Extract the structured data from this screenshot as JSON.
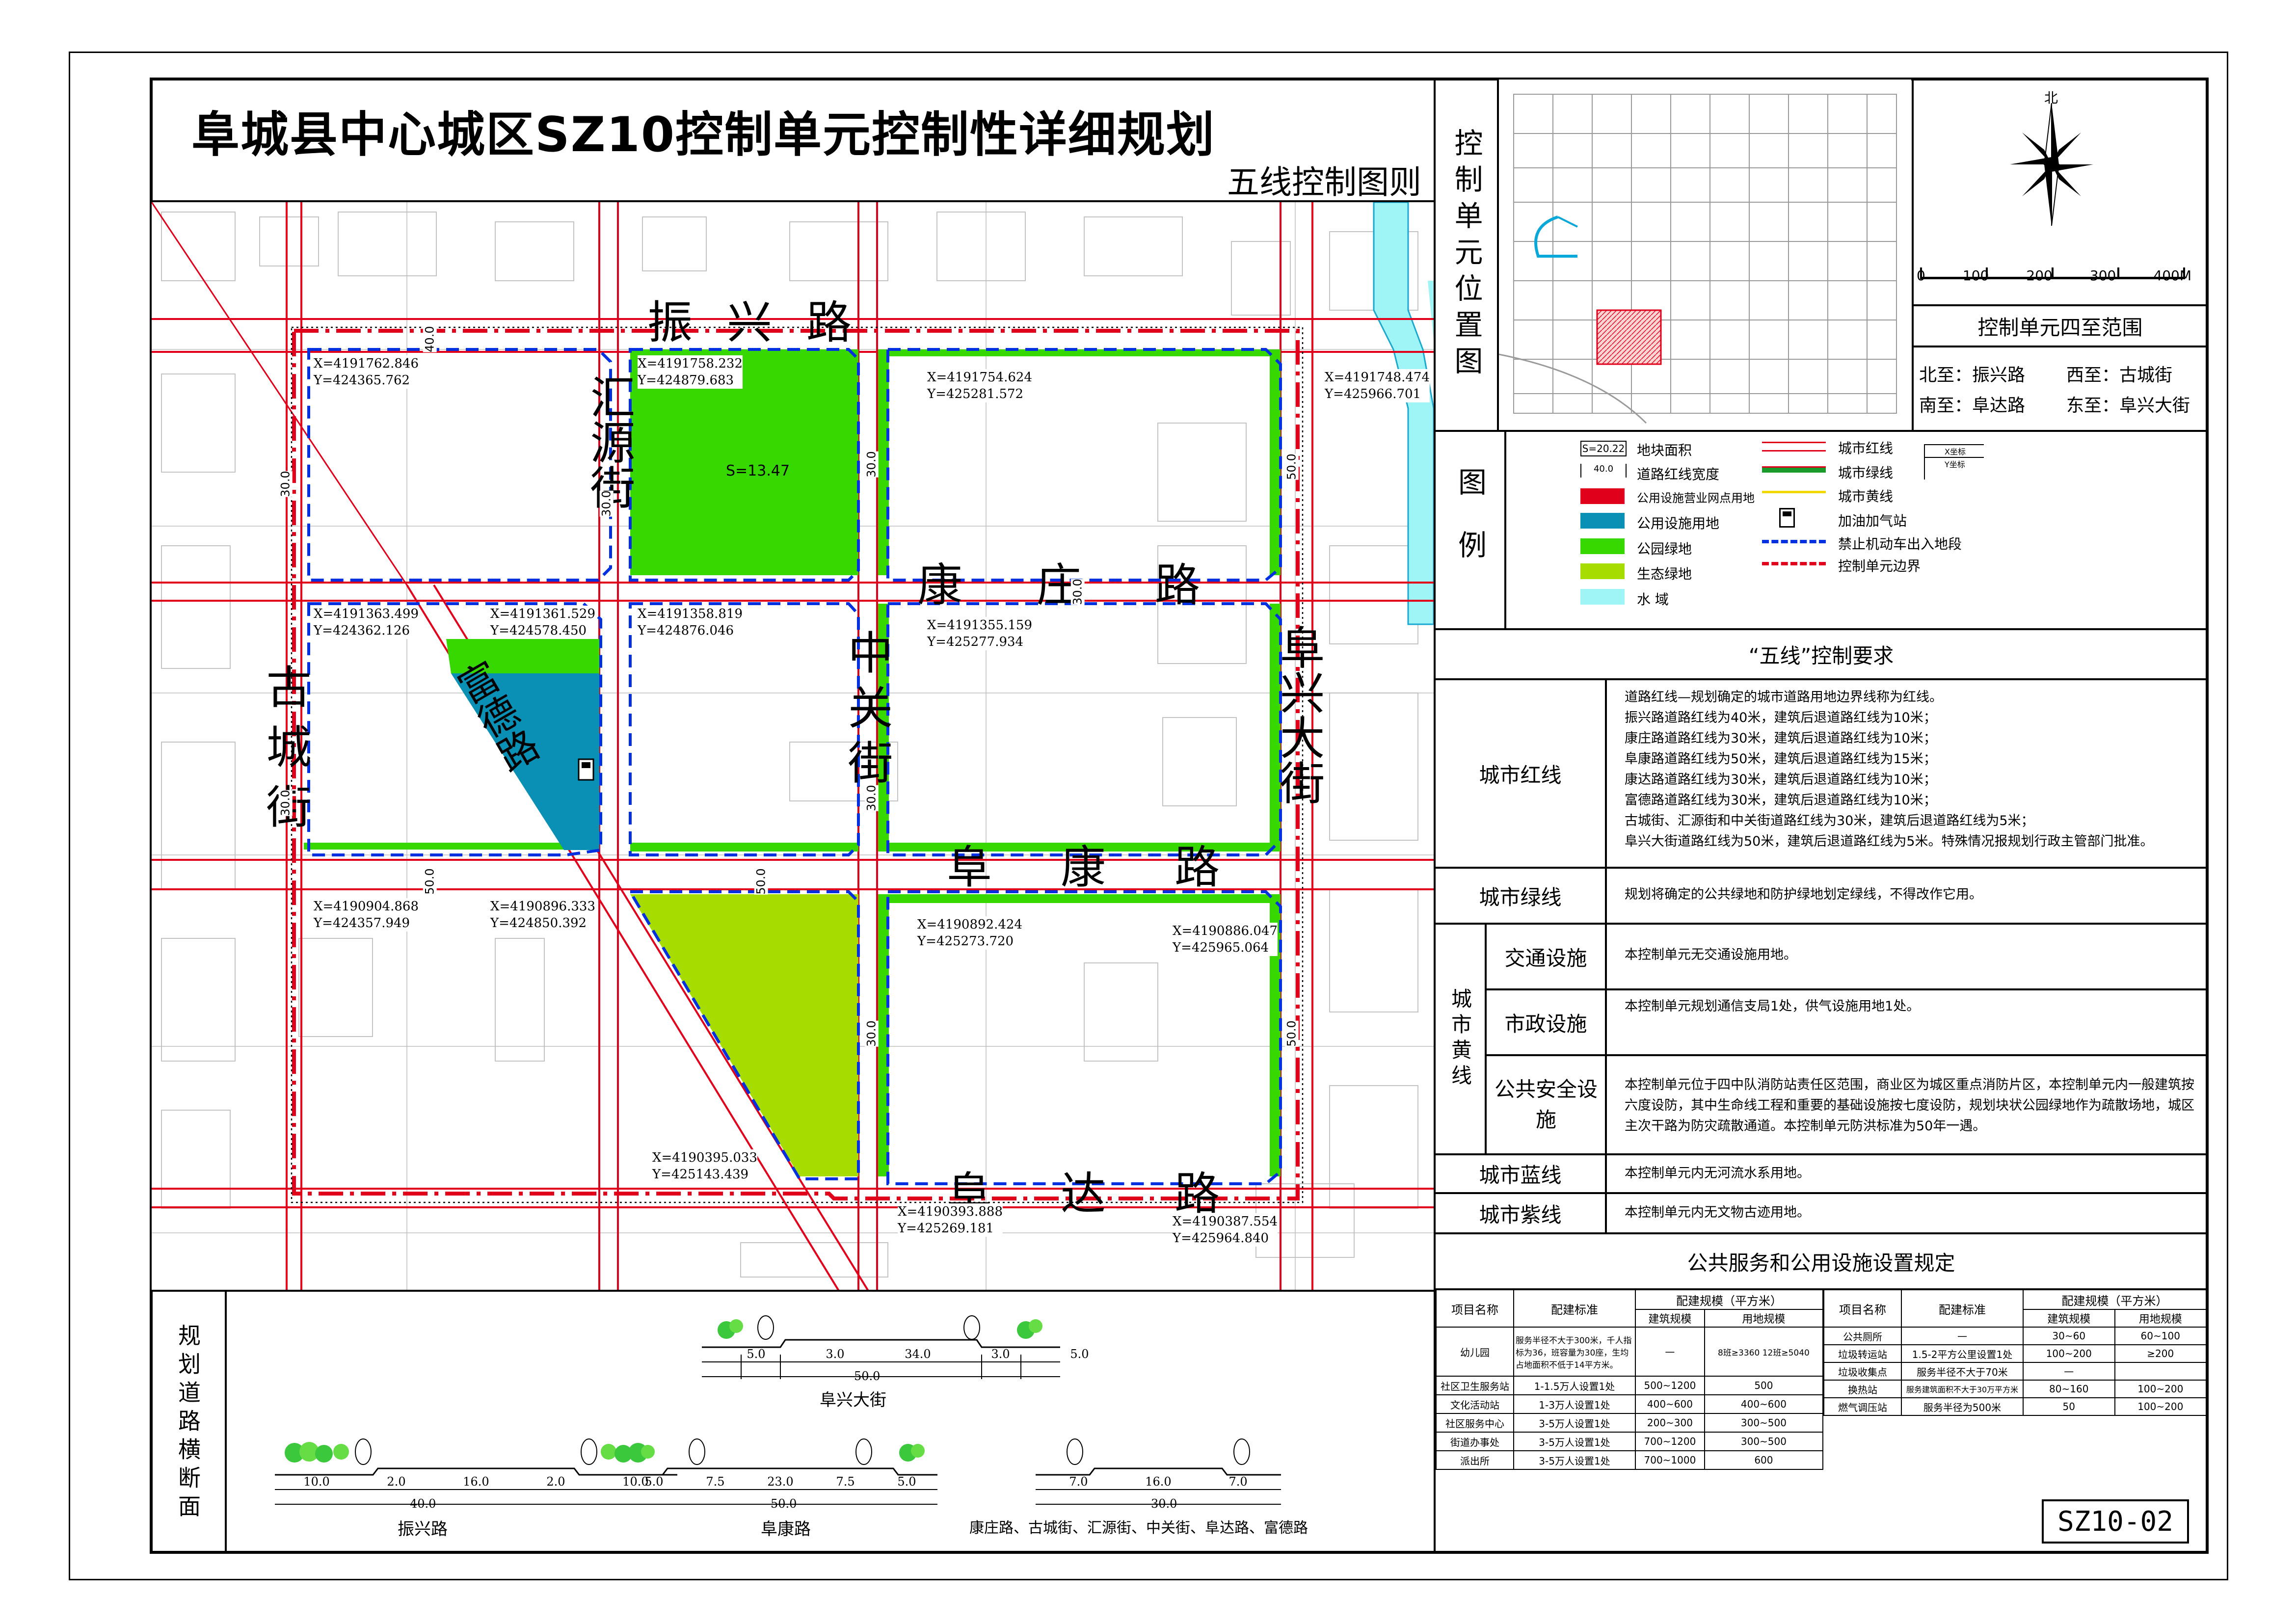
{
  "title": "阜城县中心城区SZ10控制单元控制性详细规划",
  "subtitle": "五线控制图则",
  "drawing_no": "SZ10-02",
  "roads": {
    "zhenxing": "振兴路",
    "kangzhuang": "康庄路",
    "fukang": "阜康路",
    "fuda": "阜达路",
    "gucheng": "古城街",
    "huiyuan": "汇源街",
    "zhongguan": "中关街",
    "fuxing": "阜兴大街",
    "fude": "富德路"
  },
  "parcel_area": "S=13.47",
  "coords": [
    {
      "x": "X=4191762.846",
      "y": "Y=424365.762"
    },
    {
      "x": "X=4191758.232",
      "y": "Y=424879.683"
    },
    {
      "x": "X=4191754.624",
      "y": "Y=425281.572"
    },
    {
      "x": "X=4191748.474",
      "y": "Y=425966.701"
    },
    {
      "x": "X=4191363.499",
      "y": "Y=424362.126"
    },
    {
      "x": "X=4191361.529",
      "y": "Y=424578.450"
    },
    {
      "x": "X=4191358.819",
      "y": "Y=424876.046"
    },
    {
      "x": "X=4191355.159",
      "y": "Y=425277.934"
    },
    {
      "x": "X=4190904.868",
      "y": "Y=424357.949"
    },
    {
      "x": "X=4190896.333",
      "y": "Y=424850.392"
    },
    {
      "x": "X=4190892.424",
      "y": "Y=425273.720"
    },
    {
      "x": "X=4190886.047",
      "y": "Y=425965.064"
    },
    {
      "x": "X=4190395.033",
      "y": "Y=425143.439"
    },
    {
      "x": "X=4190393.888",
      "y": "Y=425269.181"
    },
    {
      "x": "X=4190387.554",
      "y": "Y=425964.840"
    }
  ],
  "widths": [
    "30.0",
    "30.0",
    "40.0",
    "50.0",
    "50.0",
    "30.0",
    "30.0",
    "30.0",
    "50.0",
    "30.0",
    "30.0",
    "50.0"
  ],
  "location_panel": {
    "title": "控制单元位置图",
    "north": "北",
    "scale": [
      "0",
      "100",
      "200",
      "300",
      "400M"
    ],
    "bounds_title": "控制单元四至范围",
    "bounds": [
      {
        "label": "北至：振兴路"
      },
      {
        "label": "西至：古城街"
      },
      {
        "label": "南至：阜达路"
      },
      {
        "label": "东至：阜兴大街"
      }
    ]
  },
  "legend": {
    "title": "图例",
    "items_left": [
      {
        "sample": "S=20.22",
        "label": "地块面积"
      },
      {
        "sample": "40.0",
        "label": "道路红线宽度"
      },
      {
        "label": "公用设施营业网点用地",
        "color": "#e0001b"
      },
      {
        "label": "公用设施用地",
        "color": "#0a8fb5"
      },
      {
        "label": "公园绿地",
        "color": "#37d800"
      },
      {
        "label": "生态绿地",
        "color": "#a6dc00"
      },
      {
        "label": "水    域",
        "color": "#9ff5f6"
      }
    ],
    "items_right": [
      {
        "label": "城市红线",
        "color": "#e0001b"
      },
      {
        "label": "城市绿线",
        "color": "#1a9a2a"
      },
      {
        "label": "城市黄线",
        "color": "#f0d800"
      },
      {
        "label": "加油加气站"
      },
      {
        "label": "禁止机动车出入地段",
        "color": "#0030e0"
      },
      {
        "label": "控制单元边界",
        "color": "#e0001b"
      }
    ],
    "coord_sample": {
      "x": "X坐标",
      "y": "Y坐标"
    }
  },
  "requirements": {
    "title": "“五线”控制要求",
    "red_line": {
      "label": "城市红线",
      "lines": [
        "道路红线—规划确定的城市道路用地边界线称为红线。",
        "振兴路道路红线为40米，建筑后退道路红线为10米；",
        "康庄路道路红线为30米，建筑后退道路红线为10米；",
        "阜康路道路红线为50米，建筑后退道路红线为15米；",
        "康达路道路红线为30米，建筑后退道路红线为10米；",
        "富德路道路红线为30米，建筑后退道路红线为10米；",
        "古城街、汇源街和中关街道路红线为30米，建筑后退道路红线为5米；",
        "阜兴大街道路红线为50米，建筑后退道路红线为5米。特殊情况报规划行政主管部门批准。"
      ]
    },
    "green_line": {
      "label": "城市绿线",
      "text": "规划将确定的公共绿地和防护绿地划定绿线，不得改作它用。"
    },
    "yellow_line": {
      "label": "城市黄线",
      "rows": [
        {
          "label": "交通设施",
          "text": "本控制单元无交通设施用地。"
        },
        {
          "label": "市政设施",
          "text": "本控制单元规划通信支局1处，供气设施用地1处。"
        },
        {
          "label": "公共安全设施",
          "text": "本控制单元位于四中队消防站责任区范围，商业区为城区重点消防片区，本控制单元内一般建筑按六度设防，其中生命线工程和重要的基础设施按七度设防，规划块状公园绿地作为疏散场地，城区主次干路为防灾疏散通道。本控制单元防洪标准为50年一遇。"
        }
      ]
    },
    "blue_line": {
      "label": "城市蓝线",
      "text": "本控制单元内无河流水系用地。"
    },
    "purple_line": {
      "label": "城市紫线",
      "text": "本控制单元内无文物古迹用地。"
    }
  },
  "services": {
    "title": "公共服务和公用设施设置规定",
    "headers": {
      "item": "项目名称",
      "standard": "配建标准",
      "scale": "配建规模（平方米）",
      "building": "建筑规模",
      "land": "用地规模"
    },
    "left_rows": [
      {
        "item": "幼儿园",
        "standard": "服务半径不大于300米，千人指标为36，班容量为30座，生均占地面积不低于14平方米。",
        "building": "—",
        "land": "8班≥3360 12班≥5040"
      },
      {
        "item": "社区卫生服务站",
        "standard": "1-1.5万人设置1处",
        "building": "500~1200",
        "land": "500"
      },
      {
        "item": "文化活动站",
        "standard": "1-3万人设置1处",
        "building": "400~600",
        "land": "400~600"
      },
      {
        "item": "社区服务中心",
        "standard": "3-5万人设置1处",
        "building": "200~300",
        "land": "300~500"
      },
      {
        "item": "街道办事处",
        "standard": "3-5万人设置1处",
        "building": "700~1200",
        "land": "300~500"
      },
      {
        "item": "派出所",
        "standard": "3-5万人设置1处",
        "building": "700~1000",
        "land": "600"
      }
    ],
    "right_rows": [
      {
        "item": "公共厕所",
        "standard": "—",
        "building": "30~60",
        "land": "60~100"
      },
      {
        "item": "垃圾转运站",
        "standard": "1.5-2平方公里设置1处",
        "building": "100~200",
        "land": "≥200"
      },
      {
        "item": "垃圾收集点",
        "standard": "服务半径不大于70米",
        "building": "—",
        "land": ""
      },
      {
        "item": "换热站",
        "standard": "服务建筑面积不大于30万平方米",
        "building": "80~160",
        "land": "100~200"
      },
      {
        "item": "燃气调压站",
        "standard": "服务半径为500米",
        "building": "50",
        "land": "100~200"
      }
    ]
  },
  "sections": {
    "title": "规划道路横断面",
    "fuxing": {
      "name": "阜兴大街",
      "dims": [
        "5.0",
        "3.0",
        "34.0",
        "3.0",
        "5.0"
      ],
      "total": "50.0"
    },
    "zhenxing": {
      "name": "振兴路",
      "dims": [
        "10.0",
        "2.0",
        "16.0",
        "2.0",
        "10.0"
      ],
      "total": "40.0"
    },
    "fukang": {
      "name": "阜康路",
      "dims": [
        "5.0",
        "7.5",
        "23.0",
        "7.5",
        "5.0"
      ],
      "total": "50.0"
    },
    "others": {
      "name": "康庄路、古城街、汇源街、中关街、阜达路、富德路",
      "dims": [
        "7.0",
        "16.0",
        "7.0"
      ],
      "total": "30.0"
    }
  }
}
